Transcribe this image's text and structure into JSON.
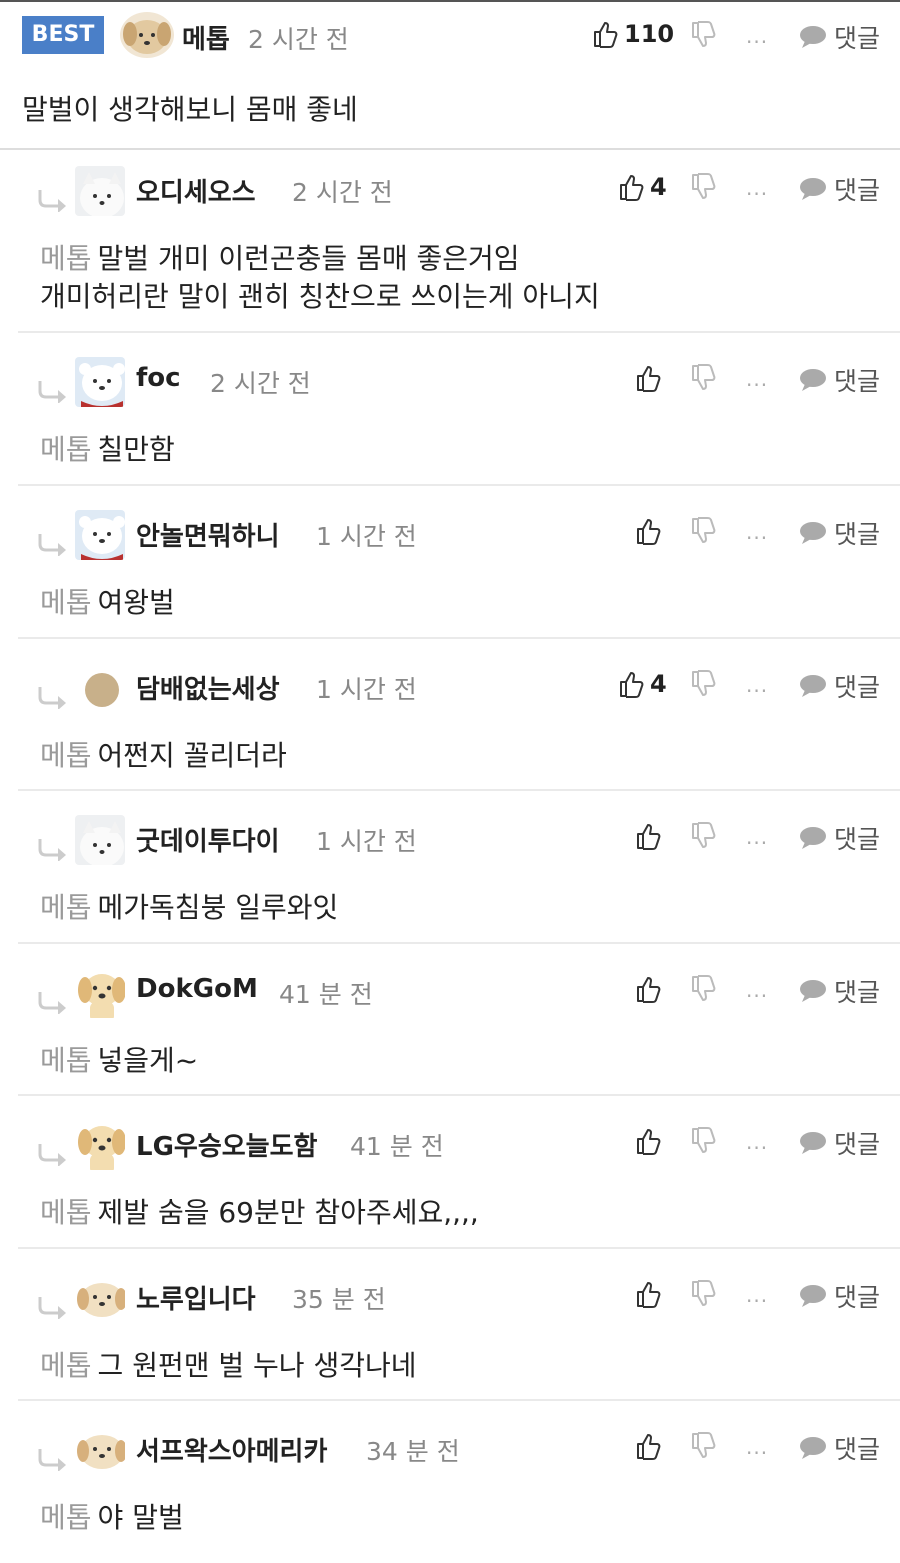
{
  "labels": {
    "reply": "댓글",
    "more": "···"
  },
  "best": {
    "badge": "BEST",
    "author": "메톱",
    "time": "2 시간 전",
    "likes": "110",
    "body": "말벌이 생각해보니 몸매 좋네"
  },
  "replies": [
    {
      "author": "오디세오스",
      "time": "2 시간 전",
      "likes": "4",
      "mention": "메톱",
      "line1": "말벌 개미 이런곤충들 몸매 좋은거임",
      "line2": "개미허리란 말이 괜히 칭찬으로 쓰이는게 아니지",
      "avatar": "white-dog"
    },
    {
      "author": "foc",
      "time": "2 시간 전",
      "likes": "",
      "mention": "메톱",
      "line1": "칠만함",
      "line2": "",
      "avatar": "polar-bear"
    },
    {
      "author": "안놀면뭐하니",
      "time": "1 시간 전",
      "likes": "",
      "mention": "메톱",
      "line1": "여왕벌",
      "line2": "",
      "avatar": "polar-bear"
    },
    {
      "author": "담배없는세상",
      "time": "1 시간 전",
      "likes": "4",
      "mention": "메톱",
      "line1": "어쩐지 꼴리더라",
      "line2": "",
      "avatar": "tan-circle"
    },
    {
      "author": "굿데이투다이",
      "time": "1 시간 전",
      "likes": "",
      "mention": "메톱",
      "line1": "메가독침붕 일루와잇",
      "line2": "",
      "avatar": "white-dog"
    },
    {
      "author": "DokGoM",
      "time": "41 분 전",
      "likes": "",
      "mention": "메톱",
      "line1": "넣을게~",
      "line2": "",
      "avatar": "puppy"
    },
    {
      "author": "LG우승오늘도함",
      "time": "41 분 전",
      "likes": "",
      "mention": "메톱",
      "line1": "제발 숨을 69분만 참아주세요,,,,",
      "line2": "",
      "avatar": "puppy"
    },
    {
      "author": "노루입니다",
      "time": "35 분 전",
      "likes": "",
      "mention": "메톱",
      "line1": "그 원펀맨 벌 누나 생각나네",
      "line2": "",
      "avatar": "puppy-face"
    },
    {
      "author": "서프왁스아메리카",
      "time": "34 분 전",
      "likes": "",
      "mention": "메톱",
      "line1": "야 말벌",
      "line2": "",
      "avatar": "puppy-face"
    }
  ]
}
